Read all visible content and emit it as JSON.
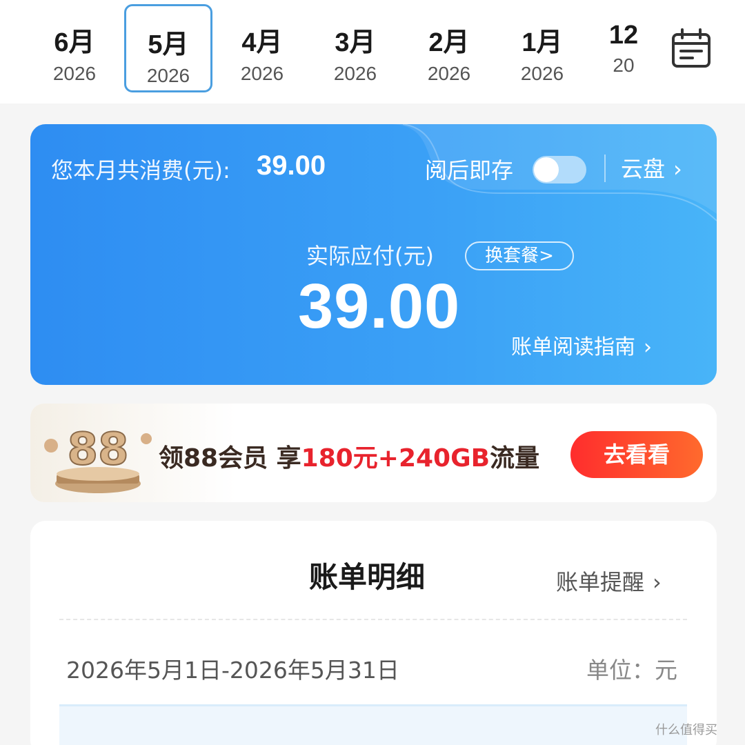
{
  "months": [
    {
      "month": "6月",
      "year": "2026",
      "selected": false
    },
    {
      "month": "5月",
      "year": "2026",
      "selected": true
    },
    {
      "month": "4月",
      "year": "2026",
      "selected": false
    },
    {
      "month": "3月",
      "year": "2026",
      "selected": false
    },
    {
      "month": "2月",
      "year": "2026",
      "selected": false
    },
    {
      "month": "1月",
      "year": "2026",
      "selected": false
    },
    {
      "month": "12",
      "year": "20",
      "selected": false
    }
  ],
  "calendar_icon": "calendar-icon",
  "summary": {
    "total_label": "您本月共消费(元):",
    "total_value": "39.00",
    "save_label": "阅后即存",
    "save_toggle_on": false,
    "cloud_label": "云盘",
    "payable_label": "实际应付(元)",
    "change_plan_label": "换套餐>",
    "payable_value": "39.00",
    "guide_label": "账单阅读指南"
  },
  "promo": {
    "badge_text": "88",
    "text_prefix": "领88会员 享",
    "text_highlight": "180元+240GB",
    "text_suffix": "流量",
    "button_label": "去看看"
  },
  "detail": {
    "title": "账单明细",
    "reminder_label": "账单提醒",
    "period": "2026年5月1日-2026年5月31日",
    "unit": "单位：元"
  },
  "watermark": "什么值得买",
  "colors": {
    "accent": "#2e8df2",
    "selected_border": "#4a9ee0",
    "promo_red": "#e8232d"
  }
}
